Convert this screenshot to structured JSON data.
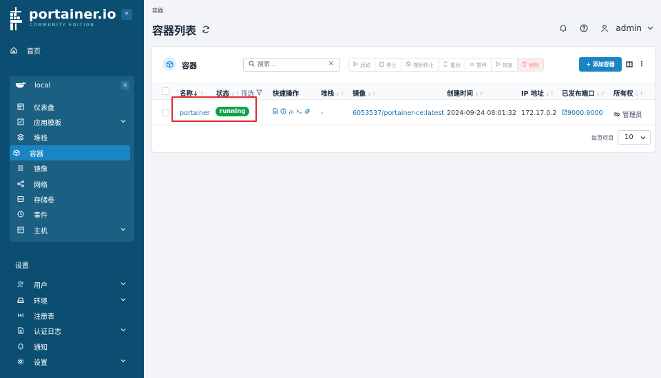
{
  "app": {
    "name": "portainer.io",
    "edition": "COMMUNITY EDITION"
  },
  "sidebar": {
    "home": "首页",
    "environment": {
      "name": "local"
    },
    "env_items": [
      {
        "label": "仪表盘",
        "icon": "dashboard-icon"
      },
      {
        "label": "应用模板",
        "icon": "template-icon",
        "chevron": true
      },
      {
        "label": "堆栈",
        "icon": "stack-icon"
      },
      {
        "label": "容器",
        "icon": "container-icon",
        "active": true
      },
      {
        "label": "镜像",
        "icon": "image-icon"
      },
      {
        "label": "网络",
        "icon": "network-icon"
      },
      {
        "label": "存储卷",
        "icon": "volume-icon"
      },
      {
        "label": "事件",
        "icon": "events-icon"
      },
      {
        "label": "主机",
        "icon": "host-icon",
        "chevron": true
      }
    ],
    "settings_title": "设置",
    "settings_items": [
      {
        "label": "用户",
        "icon": "users-icon",
        "chevron": true
      },
      {
        "label": "环境",
        "icon": "environments-icon",
        "chevron": true
      },
      {
        "label": "注册表",
        "icon": "registry-icon"
      },
      {
        "label": "认证日志",
        "icon": "auth-log-icon",
        "chevron": true
      },
      {
        "label": "通知",
        "icon": "bell-icon"
      },
      {
        "label": "设置",
        "icon": "settings-gear-icon",
        "chevron": true
      }
    ]
  },
  "header": {
    "breadcrumb": "容器",
    "title": "容器列表",
    "user": "admin"
  },
  "card": {
    "title": "容器",
    "search_placeholder": "搜索...",
    "actions": {
      "start": "启动",
      "stop": "停止",
      "kill": "强制停止",
      "restart": "重启",
      "pause": "暂停",
      "resume": "恢复",
      "remove": "删除"
    },
    "add_button": "+ 添加容器",
    "columns": {
      "name": "名称",
      "state": "状态",
      "filter": "筛选",
      "quick_actions": "快速操作",
      "stack": "堆栈",
      "image": "镜像",
      "created": "创建时间",
      "ip": "IP 地址",
      "ports": "已发布端口",
      "ownership": "所有权"
    },
    "rows": [
      {
        "name": "portainer",
        "state": "running",
        "stack": "-",
        "image": "6053537/portainer-ce:latest",
        "created": "2024-09-24 08:01:32",
        "ip": "172.17.0.2",
        "ports": "9000:9000",
        "ownership": "管理员"
      }
    ],
    "items_per_page_label": "每页项目",
    "items_per_page": "10"
  },
  "colors": {
    "sidebar": "#0b4e71",
    "accent": "#1a85c4",
    "running": "#12a04a",
    "highlight": "#e0282e"
  }
}
